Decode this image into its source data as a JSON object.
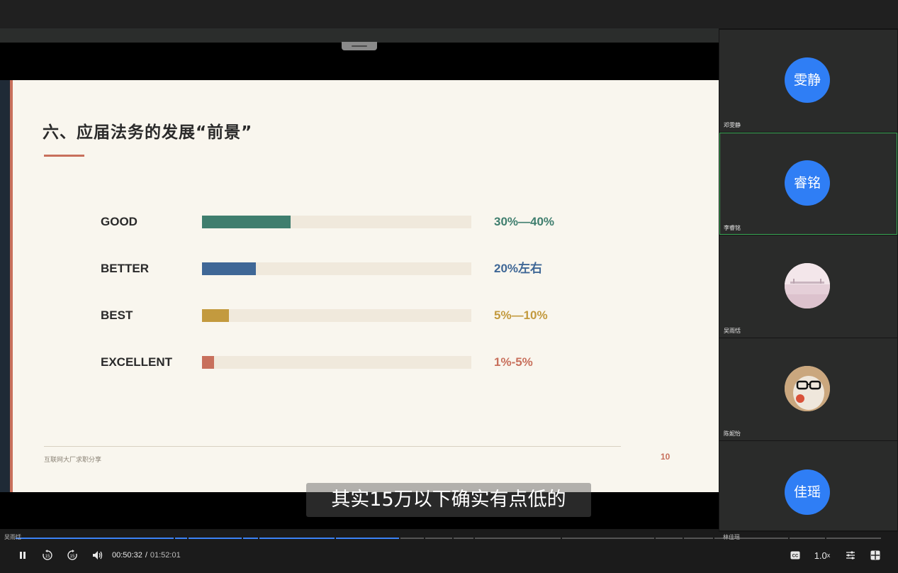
{
  "slide": {
    "title": "六、应届法务的发展“前景”",
    "rows": [
      {
        "label": "GOOD",
        "value": "30%—40%",
        "fill": 0.33,
        "color": "#3f7e6e"
      },
      {
        "label": "BETTER",
        "value": "20%左右",
        "fill": 0.2,
        "color": "#3f6796"
      },
      {
        "label": "BEST",
        "value": "5%—10%",
        "fill": 0.1,
        "color": "#c39a3e"
      },
      {
        "label": "EXCELLENT",
        "value": "1%-5%",
        "fill": 0.045,
        "color": "#c8705c"
      }
    ],
    "footer": "互联网大厂求职分享",
    "page_number": "10"
  },
  "subtitle": "其实15万以下确实有点低的",
  "participants": [
    {
      "avatar_text": "雯静",
      "name": "邓雯静",
      "active": false
    },
    {
      "avatar_text": "睿铭",
      "name": "李睿铭",
      "active": true
    },
    {
      "avatar_text": "",
      "name": "吴雨恬",
      "active": false,
      "photo": "landscape"
    },
    {
      "avatar_text": "",
      "name": "陈妮怡",
      "active": false,
      "photo": "cat"
    },
    {
      "avatar_text": "佳瑶",
      "name": "林佳瑶",
      "active": false
    }
  ],
  "meta": {
    "left_name": "吴雨恬",
    "right_name": "林佳瑶"
  },
  "player": {
    "current_time": "00:50:32",
    "separator": "/",
    "duration": "01:52:01",
    "speed": "1.0",
    "speed_suffix": "x",
    "rewind_seconds": "15",
    "forward_seconds": "15",
    "progress": 0.45
  },
  "colors": {
    "accent_blue": "#2f7ef5",
    "active_green": "#3aa856",
    "slide_accent": "#c8705c"
  }
}
